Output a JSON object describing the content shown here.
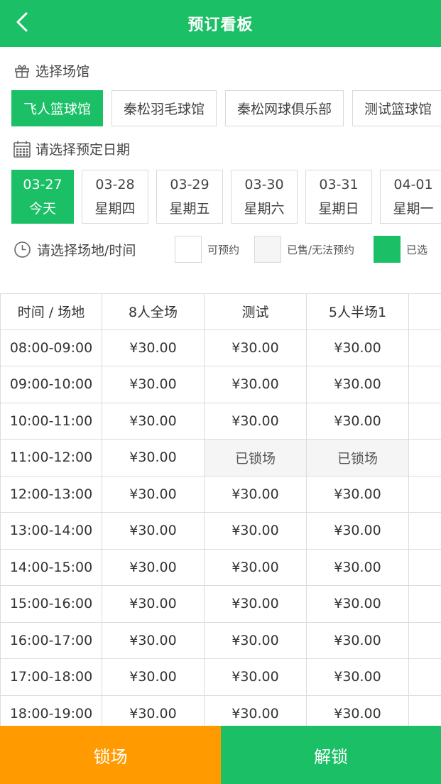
{
  "header": {
    "title": "预订看板"
  },
  "venue_section": {
    "label": "选择场馆"
  },
  "venues": [
    {
      "label": "飞人篮球馆",
      "active": true
    },
    {
      "label": "秦松羽毛球馆",
      "active": false
    },
    {
      "label": "秦松网球俱乐部",
      "active": false
    },
    {
      "label": "测试篮球馆",
      "active": false
    }
  ],
  "date_section": {
    "label": "请选择预定日期"
  },
  "dates": [
    {
      "date": "03-27",
      "day": "今天",
      "active": true
    },
    {
      "date": "03-28",
      "day": "星期四",
      "active": false
    },
    {
      "date": "03-29",
      "day": "星期五",
      "active": false
    },
    {
      "date": "03-30",
      "day": "星期六",
      "active": false
    },
    {
      "date": "03-31",
      "day": "星期日",
      "active": false
    },
    {
      "date": "04-01",
      "day": "星期一",
      "active": false
    }
  ],
  "slot_section": {
    "label": "请选择场地/时间"
  },
  "legend": [
    {
      "label": "可预约",
      "color": "#ffffff"
    },
    {
      "label": "已售/无法预约",
      "color": "#f6f5f5"
    },
    {
      "label": "已选",
      "color": "#1bbf66"
    }
  ],
  "table": {
    "headers": [
      "时间 / 场地",
      "8人全场",
      "测试",
      "5人半场1",
      ""
    ],
    "rows": [
      {
        "time": "08:00-09:00",
        "cells": [
          "¥30.00",
          "¥30.00",
          "¥30.00",
          "¥"
        ]
      },
      {
        "time": "09:00-10:00",
        "cells": [
          "¥30.00",
          "¥30.00",
          "¥30.00",
          "¥"
        ]
      },
      {
        "time": "10:00-11:00",
        "cells": [
          "¥30.00",
          "¥30.00",
          "¥30.00",
          "¥"
        ]
      },
      {
        "time": "11:00-12:00",
        "cells": [
          "¥30.00",
          "已锁场",
          "已锁场",
          "¥"
        ]
      },
      {
        "time": "12:00-13:00",
        "cells": [
          "¥30.00",
          "¥30.00",
          "¥30.00",
          "¥"
        ]
      },
      {
        "time": "13:00-14:00",
        "cells": [
          "¥30.00",
          "¥30.00",
          "¥30.00",
          "¥"
        ]
      },
      {
        "time": "14:00-15:00",
        "cells": [
          "¥30.00",
          "¥30.00",
          "¥30.00",
          "¥"
        ]
      },
      {
        "time": "15:00-16:00",
        "cells": [
          "¥30.00",
          "¥30.00",
          "¥30.00",
          "¥"
        ]
      },
      {
        "time": "16:00-17:00",
        "cells": [
          "¥30.00",
          "¥30.00",
          "¥30.00",
          "¥"
        ]
      },
      {
        "time": "17:00-18:00",
        "cells": [
          "¥30.00",
          "¥30.00",
          "¥30.00",
          "¥"
        ]
      },
      {
        "time": "18:00-19:00",
        "cells": [
          "¥30.00",
          "¥30.00",
          "¥30.00",
          "¥"
        ]
      }
    ]
  },
  "footer": {
    "lock_label": "锁场",
    "unlock_label": "解锁"
  },
  "colors": {
    "primary": "#1bbf66",
    "lock": "#ff9b00",
    "locked_cell": "#f6f5f5"
  }
}
